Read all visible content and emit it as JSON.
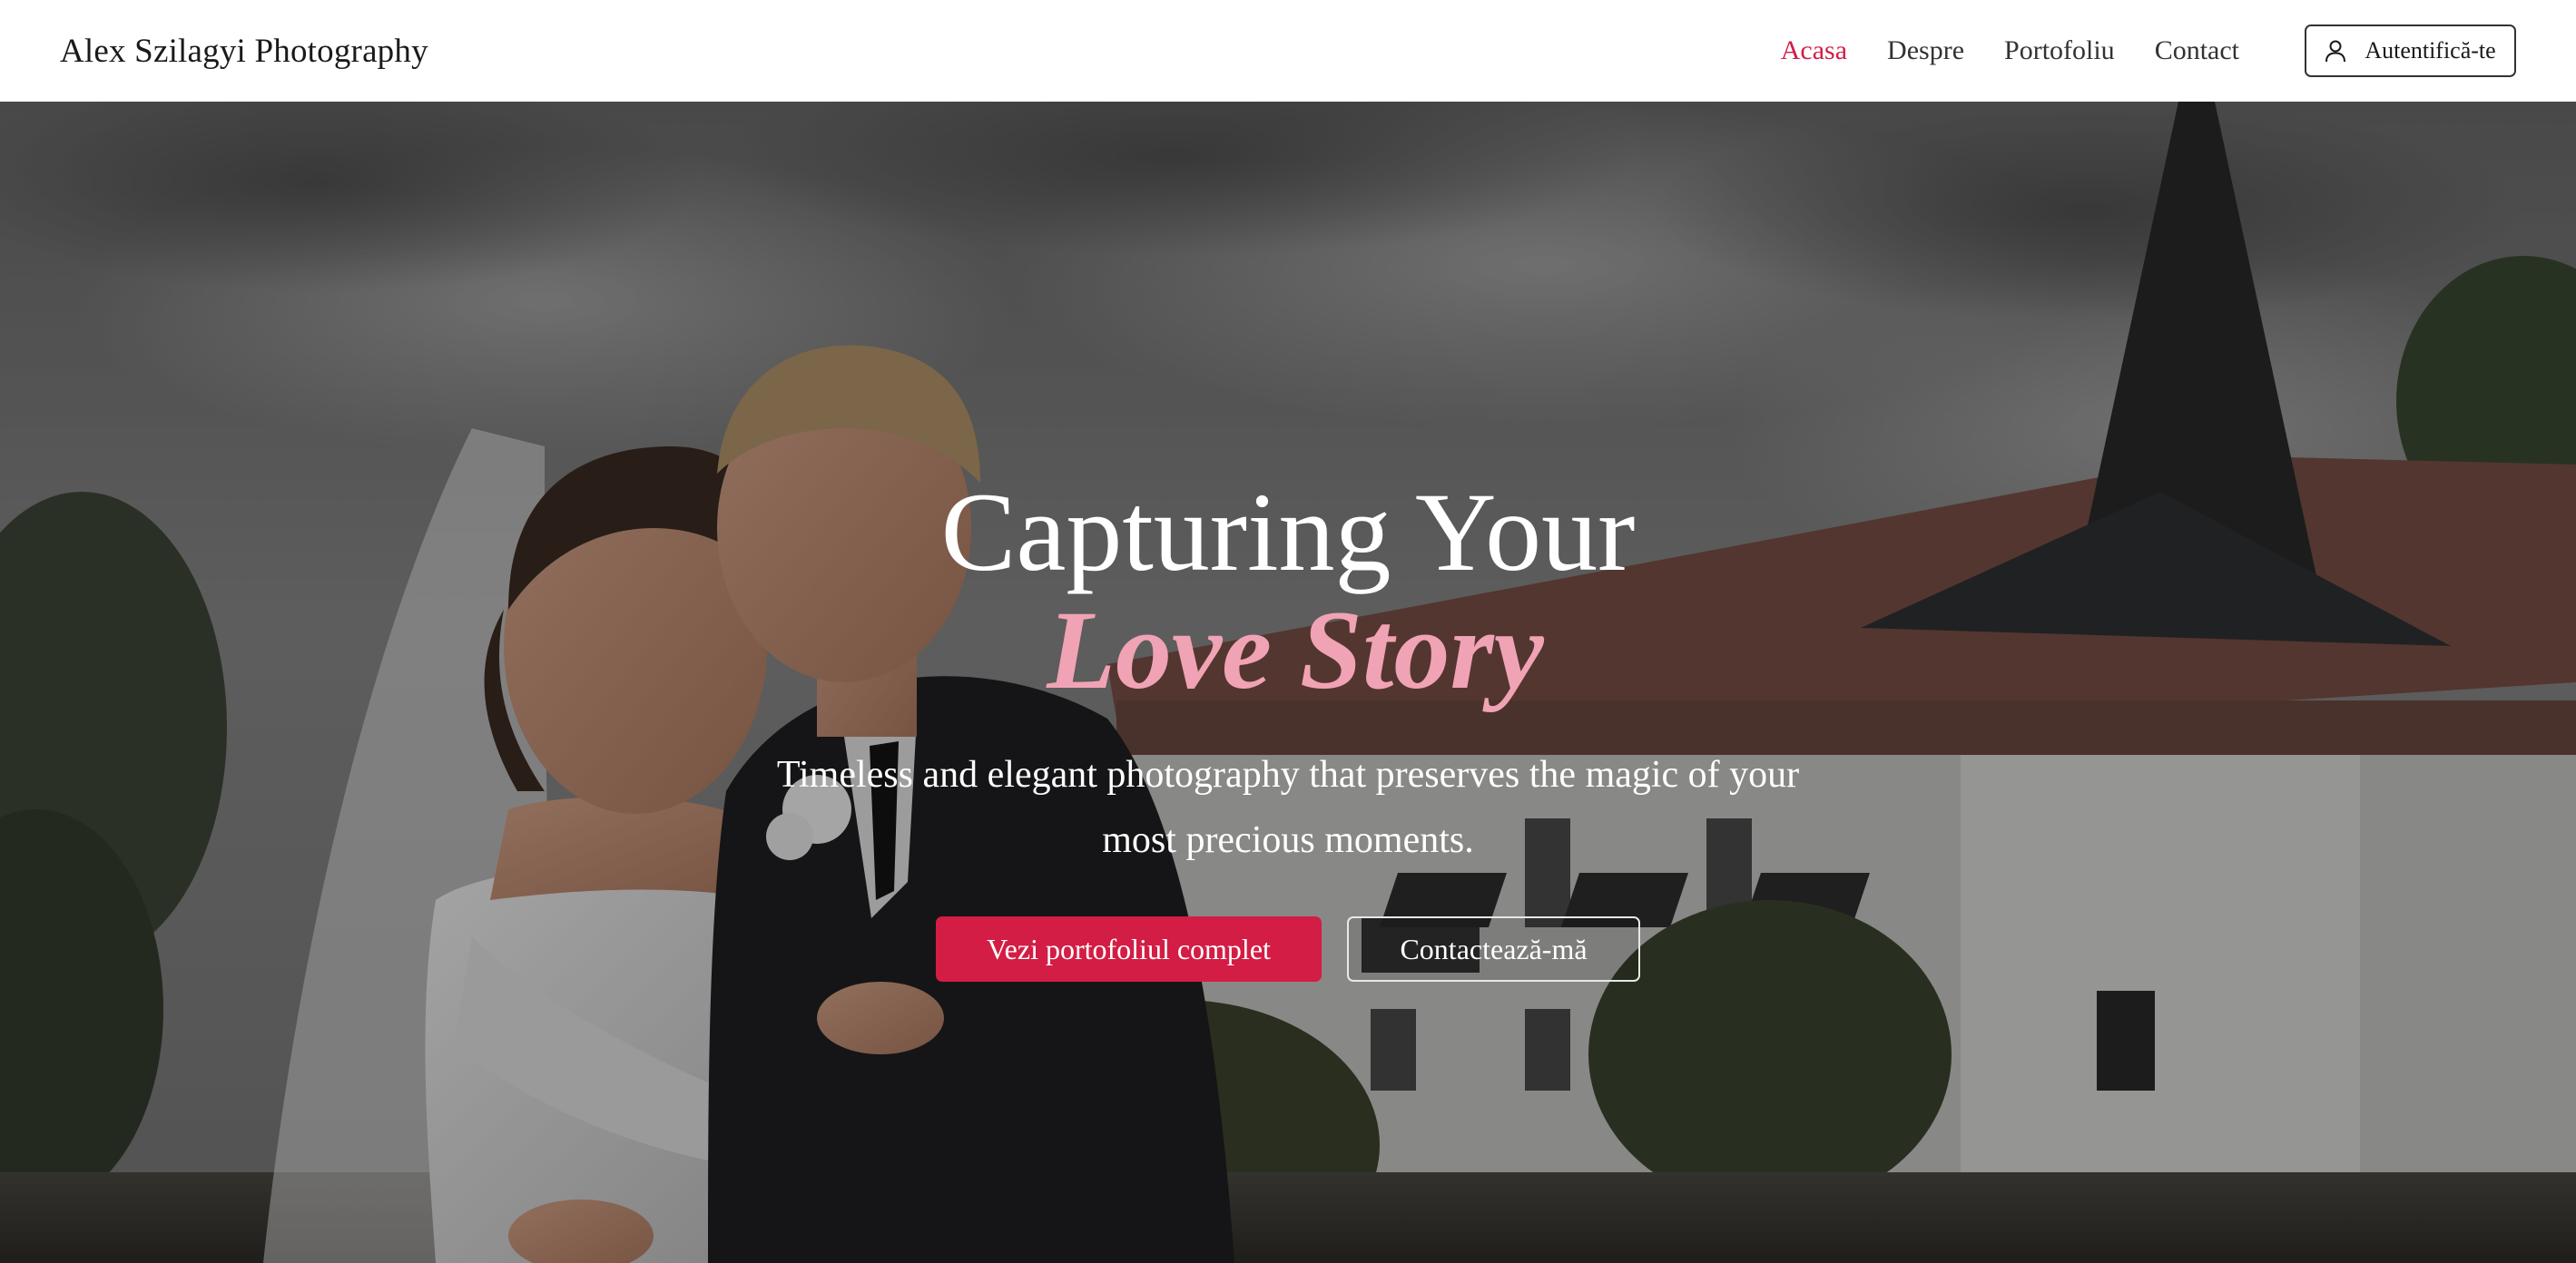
{
  "header": {
    "brand": "Alex Szilagyi Photography",
    "nav": [
      {
        "label": "Acasa",
        "active": true
      },
      {
        "label": "Despre",
        "active": false
      },
      {
        "label": "Portofoliu",
        "active": false
      },
      {
        "label": "Contact",
        "active": false
      }
    ],
    "login_label": "Autentifică-te",
    "login_icon": "user-icon"
  },
  "hero": {
    "title_line1": "Capturing Your",
    "title_line2": "Love Story",
    "subtitle": "Timeless and elegant photography that preserves the magic of your most precious moments.",
    "primary_button": "Vezi portofoliul complet",
    "secondary_button": "Contactează-mă",
    "background_image": "wedding-couple-photo"
  },
  "colors": {
    "accent": "#d31d45",
    "accent_light": "#f0a3b4",
    "text_dark": "#1a1a1a"
  }
}
